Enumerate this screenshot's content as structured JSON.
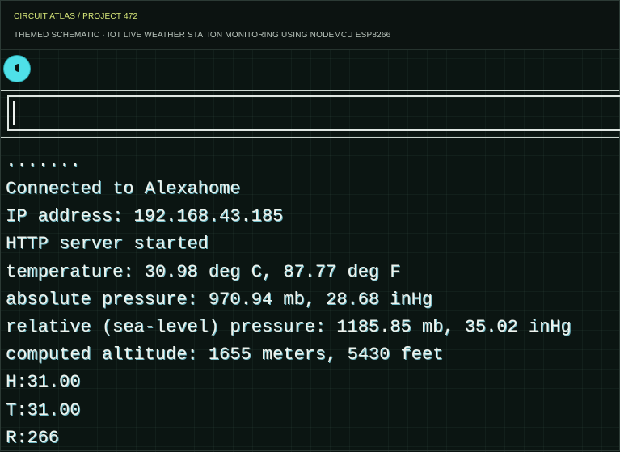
{
  "header": {
    "breadcrumb": "CIRCUIT ATLAS / PROJECT 472",
    "subtitle": "THEMED SCHEMATIC · IOT LIVE WEATHER STATION MONITORING USING NODEMCU ESP8266"
  },
  "colors": {
    "background": "#0b1512",
    "accent": "#4fe0e8",
    "breadcrumb": "#d8e87a",
    "text": "#eef3ee"
  },
  "toolbar": {
    "reset_icon": "reset-circle-icon"
  },
  "input": {
    "value": "",
    "placeholder": ""
  },
  "serial_log": [
    ".......",
    "Connected to Alexahome",
    "IP address: 192.168.43.185",
    "HTTP server started",
    "temperature: 30.98 deg C, 87.77 deg F",
    "absolute pressure: 970.94 mb, 28.68 inHg",
    "relative (sea-level) pressure: 1185.85 mb, 35.02 inHg",
    "computed altitude: 1655 meters, 5430 feet",
    "H:31.00",
    "T:31.00",
    "R:266"
  ]
}
